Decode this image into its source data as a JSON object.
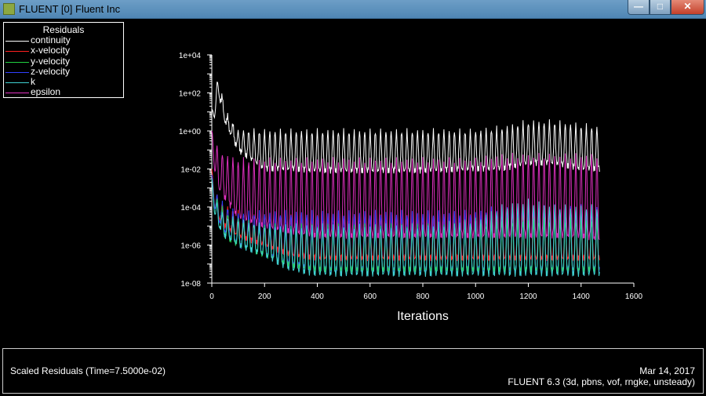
{
  "window": {
    "title": "FLUENT [0] Fluent Inc",
    "buttons": {
      "minimize": "—",
      "maximize": "□",
      "close": "✕"
    }
  },
  "footer": {
    "left": "Scaled Residuals  (Time=7.5000e-02)",
    "date": "Mar 14, 2017",
    "version": "FLUENT 6.3 (3d, pbns, vof, rngke, unsteady)"
  },
  "chart_data": {
    "type": "line",
    "title": "Residuals",
    "xlabel": "Iterations",
    "ylabel": "",
    "xlim": [
      0,
      1600
    ],
    "ylim": [
      1e-08,
      10000.0
    ],
    "yscale": "log",
    "xticks": [
      "0",
      "200",
      "400",
      "600",
      "800",
      "1000",
      "1200",
      "1400",
      "1600"
    ],
    "yticks": [
      "1e-08",
      "1e-06",
      "1e-04",
      "1e-02",
      "1e+00",
      "1e+02",
      "1e+04"
    ],
    "legend_position": "top-left",
    "last_iteration": 1470,
    "oscillation_period": 20,
    "envelope_x": [
      0,
      10,
      25,
      50,
      100,
      200,
      300,
      400,
      600,
      800,
      1000,
      1100,
      1200,
      1300,
      1400,
      1470
    ],
    "series": [
      {
        "name": "continuity",
        "color": "#ffffff",
        "peak": [
          10,
          50,
          1000,
          10,
          1,
          1,
          1,
          1,
          1,
          1,
          1,
          1.5,
          3,
          3,
          2,
          1.5
        ],
        "trough": [
          10,
          5,
          100,
          3,
          0.1,
          0.01,
          0.01,
          0.008,
          0.008,
          0.008,
          0.01,
          0.01,
          0.02,
          0.02,
          0.01,
          0.01
        ]
      },
      {
        "name": "x-velocity",
        "color": "#ff2020",
        "peak": [
          0.01,
          0.001,
          0.0003,
          0.0001,
          5e-05,
          3e-05,
          3e-05,
          3e-05,
          3e-05,
          3e-05,
          3e-05,
          5e-05,
          5e-05,
          5e-05,
          5e-05,
          5e-05
        ],
        "trough": [
          0.01,
          0.0001,
          3e-05,
          1e-05,
          3e-06,
          1e-06,
          3e-07,
          2e-07,
          2e-07,
          2e-07,
          2e-07,
          2e-07,
          2e-07,
          2e-07,
          2e-07,
          2e-07
        ]
      },
      {
        "name": "y-velocity",
        "color": "#20d040",
        "peak": [
          0.003,
          0.0005,
          0.0002,
          5e-05,
          2e-05,
          1e-05,
          1e-05,
          1e-05,
          1e-05,
          1e-05,
          1e-05,
          2e-05,
          2e-05,
          2e-05,
          2e-05,
          2e-05
        ],
        "trough": [
          0.003,
          5e-05,
          1e-05,
          3e-06,
          1e-06,
          3e-07,
          8e-08,
          5e-08,
          5e-08,
          5e-08,
          5e-08,
          5e-08,
          5e-08,
          5e-08,
          5e-08,
          5e-08
        ]
      },
      {
        "name": "z-velocity",
        "color": "#3040ff",
        "peak": [
          0.005,
          0.001,
          0.0003,
          0.0001,
          5e-05,
          5e-05,
          5e-05,
          5e-05,
          5e-05,
          5e-05,
          5e-05,
          0.0001,
          0.0001,
          0.0001,
          0.0001,
          0.0001
        ],
        "trough": [
          0.005,
          0.0001,
          2e-05,
          5e-06,
          1e-06,
          3e-07,
          1e-07,
          5e-08,
          5e-08,
          5e-08,
          5e-08,
          5e-08,
          5e-08,
          5e-08,
          5e-08,
          5e-08
        ]
      },
      {
        "name": "k",
        "color": "#40d0d0",
        "peak": [
          0.003,
          0.0005,
          0.0001,
          3e-05,
          2e-05,
          1e-05,
          1e-05,
          1e-05,
          1e-05,
          1e-05,
          2e-05,
          0.0001,
          0.0002,
          0.0001,
          0.0001,
          0.0001
        ],
        "trough": [
          0.003,
          5e-05,
          1e-05,
          3e-06,
          1e-06,
          3e-07,
          5e-08,
          3e-08,
          3e-08,
          3e-08,
          3e-08,
          3e-08,
          3e-08,
          3e-08,
          3e-08,
          3e-08
        ]
      },
      {
        "name": "epsilon",
        "color": "#e030c0",
        "peak": [
          1,
          0.5,
          0.1,
          0.05,
          0.03,
          0.03,
          0.03,
          0.03,
          0.03,
          0.03,
          0.03,
          0.05,
          0.05,
          0.05,
          0.05,
          0.05
        ],
        "trough": [
          1,
          0.01,
          0.001,
          0.0003,
          3e-05,
          1e-05,
          5e-06,
          3e-06,
          3e-06,
          3e-06,
          3e-06,
          3e-06,
          3e-06,
          3e-06,
          3e-06,
          2e-06
        ]
      }
    ]
  }
}
